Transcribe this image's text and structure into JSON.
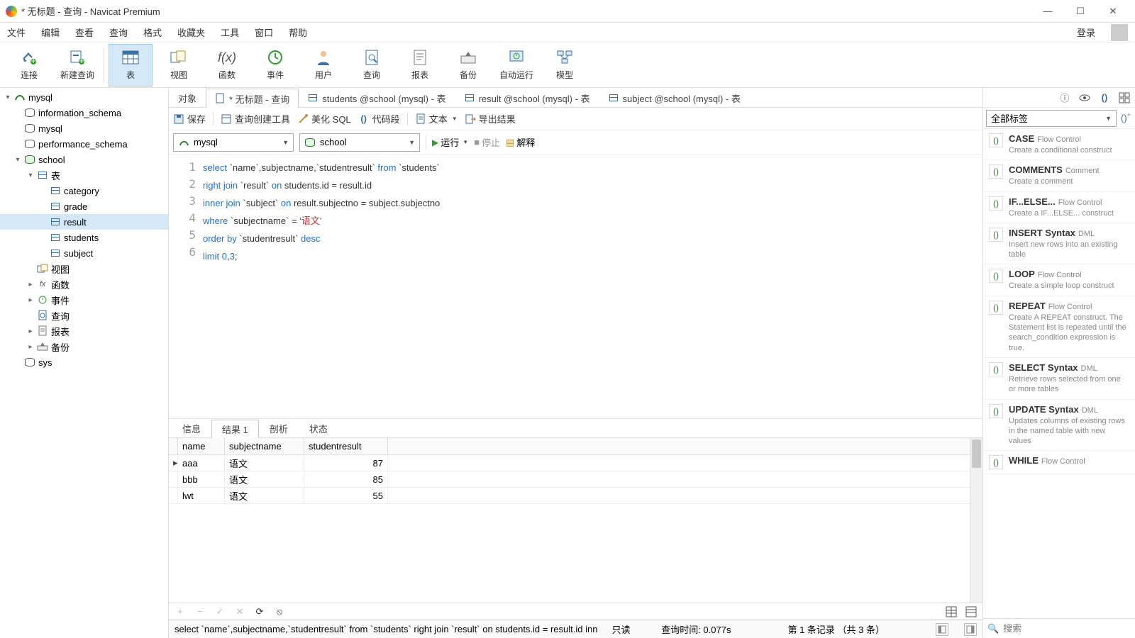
{
  "window": {
    "title": "* 无标题 - 查询 - Navicat Premium"
  },
  "menu": {
    "file": "文件",
    "edit": "编辑",
    "view": "查看",
    "query": "查询",
    "format": "格式",
    "fav": "收藏夹",
    "tools": "工具",
    "window": "窗口",
    "help": "帮助",
    "login": "登录"
  },
  "ribbon": {
    "connect": "连接",
    "newquery": "新建查询",
    "table": "表",
    "view": "视图",
    "fn": "函数",
    "event": "事件",
    "user": "用户",
    "query": "查询",
    "report": "报表",
    "backup": "备份",
    "auto": "自动运行",
    "model": "模型"
  },
  "tree": {
    "conn": "mysql",
    "dbs": {
      "info_schema": "information_schema",
      "mysql": "mysql",
      "perf_schema": "performance_schema",
      "school": "school",
      "sys": "sys"
    },
    "school_folders": {
      "tables": "表",
      "views": "视图",
      "functions": "函数",
      "events": "事件",
      "queries": "查询",
      "reports": "报表",
      "backups": "备份"
    },
    "tables": {
      "category": "category",
      "grade": "grade",
      "result": "result",
      "students": "students",
      "subject": "subject"
    }
  },
  "tabs": {
    "objects": "对象",
    "untitled": "* 无标题 - 查询",
    "students": "students @school (mysql) - 表",
    "result": "result @school (mysql) - 表",
    "subject": "subject @school (mysql) - 表"
  },
  "qtoolbar": {
    "save": "保存",
    "builder": "查询创建工具",
    "beautify": "美化 SQL",
    "snippet": "代码段",
    "text": "文本",
    "export": "导出结果"
  },
  "conn": {
    "connection": "mysql",
    "database": "school",
    "run": "运行",
    "stop": "停止",
    "explain": "解释"
  },
  "sql": {
    "l1a": "select",
    "l1b": " `name`,subjectname,`studentresult` ",
    "l1c": "from",
    "l1d": " `students`",
    "l2a": "right",
    "l2b": " ",
    "l2c": "join",
    "l2d": " `result` ",
    "l2e": "on",
    "l2f": " students.id = result.id",
    "l3a": "inner",
    "l3b": " ",
    "l3c": "join",
    "l3d": " `subject` ",
    "l3e": "on",
    "l3f": " result.subjectno = subject.subjectno",
    "l4a": "where",
    "l4b": " `subjectname` = ",
    "l4c": "'语文'",
    "l5a": "order",
    "l5b": " ",
    "l5c": "by",
    "l5d": " `studentresult` ",
    "l5e": "desc",
    "l6a": "limit",
    "l6b": " ",
    "l6c": "0",
    "l6d": ",",
    "l6e": "3",
    "l6f": ";"
  },
  "result_tabs": {
    "info": "信息",
    "result1": "结果 1",
    "profile": "剖析",
    "status": "状态"
  },
  "columns": {
    "name": "name",
    "subjectname": "subjectname",
    "studentresult": "studentresult"
  },
  "rows": [
    {
      "name": "aaa",
      "subjectname": "语文",
      "studentresult": "87"
    },
    {
      "name": "bbb",
      "subjectname": "语文",
      "studentresult": "85"
    },
    {
      "name": "lwt",
      "subjectname": "语文",
      "studentresult": "55"
    }
  ],
  "gridfoot": {
    "plus": "+",
    "minus": "−",
    "check": "✓",
    "cross": "✕",
    "refresh": "⟳",
    "stop": "⦸"
  },
  "status": {
    "sql": "select `name`,subjectname,`studentresult` from `students` right join `result` on students.id = result.id inn",
    "readonly": "只读",
    "time": "查询时间: 0.077s",
    "record": "第 1 条记录 （共 3 条）"
  },
  "rp": {
    "all_tags": "全部标签",
    "items": [
      {
        "title": "CASE",
        "cat": "Flow Control",
        "desc": "Create a conditional construct"
      },
      {
        "title": "COMMENTS",
        "cat": "Comment",
        "desc": "Create a comment"
      },
      {
        "title": "IF...ELSE...",
        "cat": "Flow Control",
        "desc": "Create a IF...ELSE... construct"
      },
      {
        "title": "INSERT Syntax",
        "cat": "DML",
        "desc": "Insert new rows into an existing table"
      },
      {
        "title": "LOOP",
        "cat": "Flow Control",
        "desc": "Create a simple loop construct"
      },
      {
        "title": "REPEAT",
        "cat": "Flow Control",
        "desc": "Create A REPEAT construct. The Statement list is repeated until the search_condition expression is true."
      },
      {
        "title": "SELECT Syntax",
        "cat": "DML",
        "desc": "Retrieve rows selected from one or more tables"
      },
      {
        "title": "UPDATE Syntax",
        "cat": "DML",
        "desc": "Updates columns of existing rows in the named table with new values"
      },
      {
        "title": "WHILE",
        "cat": "Flow Control",
        "desc": ""
      }
    ],
    "search_placeholder": "搜索"
  }
}
